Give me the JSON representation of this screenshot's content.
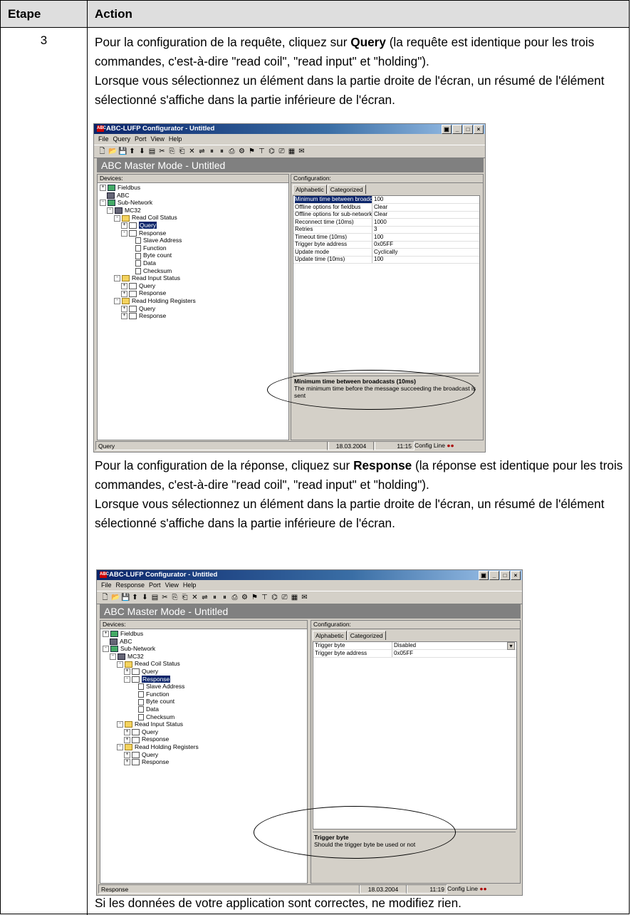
{
  "header": {
    "col1": "Etape",
    "col2": "Action"
  },
  "step": "3",
  "para1": {
    "a": "Pour la configuration de la requête, cliquez sur ",
    "b": "Query",
    "c": " (la requête est identique pour les trois commandes, c'est-à-dire \"read coil\", \"read input\" et \"holding\").",
    "d": "Lorsque vous sélectionnez un élément dans la partie droite de l'écran, un résumé de l'élément sélectionné s'affiche dans la partie inférieure de l'écran."
  },
  "para2": {
    "a": "Pour la configuration de la réponse, cliquez sur ",
    "b": "Response",
    "c": " (la réponse est identique pour les trois commandes, c'est-à-dire \"read coil\", \"read input\" et \"holding\").",
    "d": "Lorsque vous sélectionnez un élément dans la partie droite de l'écran, un résumé de l'élément sélectionné s'affiche dans la partie inférieure de l'écran."
  },
  "para3": "Si les données de votre application sont correctes, ne modifiez rien.",
  "shot1": {
    "title": "ABC-LUFP Configurator - Untitled",
    "menu": [
      "File",
      "Query",
      "Port",
      "View",
      "Help"
    ],
    "banner": "ABC Master Mode - Untitled",
    "devices_label": "Devices:",
    "config_label": "Configuration:",
    "tabs": [
      "Alphabetic",
      "Categorized"
    ],
    "tree": [
      "Fieldbus",
      "ABC",
      "Sub-Network",
      "MC32",
      "Read Coil Status",
      "Query",
      "Response",
      "Slave Address",
      "Function",
      "Byte count",
      "Data",
      "Checksum",
      "Read Input Status",
      "Query",
      "Response",
      "Read Holding Registers",
      "Query",
      "Response"
    ],
    "props": [
      {
        "k": "Minimum time between broadcasts (10ms)",
        "v": "100"
      },
      {
        "k": "Offline options for fieldbus",
        "v": "Clear"
      },
      {
        "k": "Offline options for sub-network",
        "v": "Clear"
      },
      {
        "k": "Reconnect time (10ms)",
        "v": "1000"
      },
      {
        "k": "Retries",
        "v": "3"
      },
      {
        "k": "Timeout time (10ms)",
        "v": "100"
      },
      {
        "k": "Trigger byte address",
        "v": "0x05FF"
      },
      {
        "k": "Update mode",
        "v": "Cyclically"
      },
      {
        "k": "Update time (10ms)",
        "v": "100"
      }
    ],
    "desc_title": "Minimum time between broadcasts (10ms)",
    "desc_text": "The minimum time before the message succeeding the broadcast is sent",
    "status": {
      "left": "Query",
      "date": "18.03.2004",
      "time": "11:15",
      "line": "Config Line"
    }
  },
  "shot2": {
    "title": "ABC-LUFP Configurator - Untitled",
    "menu": [
      "File",
      "Response",
      "Port",
      "View",
      "Help"
    ],
    "banner": "ABC Master Mode - Untitled",
    "devices_label": "Devices:",
    "config_label": "Configuration:",
    "tabs": [
      "Alphabetic",
      "Categorized"
    ],
    "tree": [
      "Fieldbus",
      "ABC",
      "Sub-Network",
      "MC32",
      "Read Coil Status",
      "Query",
      "Response",
      "Slave Address",
      "Function",
      "Byte count",
      "Data",
      "Checksum",
      "Read Input Status",
      "Query",
      "Response",
      "Read Holding Registers",
      "Query",
      "Response"
    ],
    "props": [
      {
        "k": "Trigger byte",
        "v": "Disabled"
      },
      {
        "k": "Trigger byte address",
        "v": "0x05FF"
      }
    ],
    "desc_title": "Trigger byte",
    "desc_text": "Should the trigger byte be used or not",
    "status": {
      "left": "Response",
      "date": "18.03.2004",
      "time": "11:19",
      "line": "Config Line"
    }
  }
}
